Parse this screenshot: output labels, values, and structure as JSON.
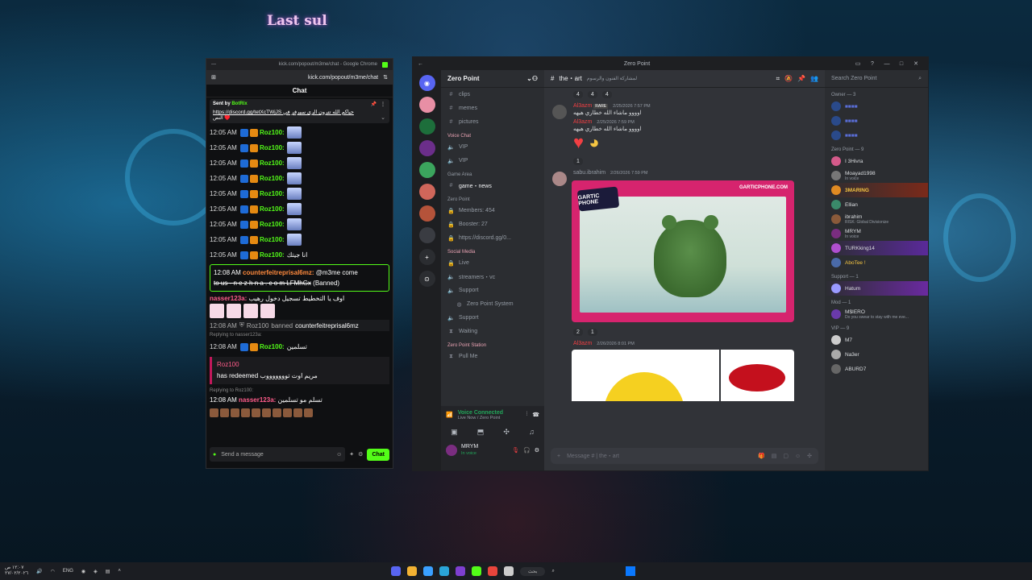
{
  "overlay": {
    "title": "Last sul"
  },
  "chat_window": {
    "chrome_title": "kick.com/popout/m3me/chat - Google Chrome",
    "url": "kick.com/popout/m3me/chat",
    "header": "Chat",
    "pinned": {
      "sent_by_label": "Sent by",
      "sent_by_user": "BotRix",
      "link": "https://discord.gg/tetXcTWjJS حياكم الله تترون الرى سيرفر في",
      "tail": "النص ♥️"
    },
    "rows": [
      {
        "time": "12:05 AM",
        "user": "Roz100:"
      },
      {
        "time": "12:05 AM",
        "user": "Roz100:"
      },
      {
        "time": "12:05 AM",
        "user": "Roz100:"
      },
      {
        "time": "12:05 AM",
        "user": "Roz100:"
      },
      {
        "time": "12:05 AM",
        "user": "Roz100:"
      },
      {
        "time": "12:05 AM",
        "user": "Roz100:"
      },
      {
        "time": "12:05 AM",
        "user": "Roz100:"
      },
      {
        "time": "12:05 AM",
        "user": "Roz100:"
      }
    ],
    "last_roz": {
      "time": "12:05 AM",
      "user": "Roz100:",
      "text": "انا جيتك"
    },
    "highlight": {
      "time": "12:08 AM",
      "user": "counterfeitreprisal6mz:",
      "text": "@m3me come",
      "text2": "to us - n e z h n a . c o m LFMhGx",
      "status": "(Banned)"
    },
    "nasser_msg": {
      "user": "nasser123a:",
      "text": "اوف يا التخطيط تسجيل دخول رهيب"
    },
    "mod_line": {
      "time": "12:08 AM",
      "user": "Roz100",
      "action": "banned",
      "target": "counterfeitreprisal6mz"
    },
    "reply1": "Replying to nasser123a:",
    "reply_row": {
      "time": "12:08 AM",
      "user": "Roz100:",
      "text": "تسلمين"
    },
    "redeem": {
      "user": "Roz100",
      "text": "has redeemed",
      "reward": "مريم اوت توووووووب"
    },
    "reply2": "Replying to Roz100:",
    "reply2_row": {
      "time": "12:08 AM",
      "user": "nasser123a:",
      "text": "تسلم مو تسلمين"
    },
    "input_placeholder": "Send a message",
    "chat_button": "Chat"
  },
  "discord": {
    "window_title": "Zero Point",
    "server_name": "Zero Point",
    "channel_title": "the・art",
    "channel_desc": "لمشاركة الفنون والرسوم",
    "search_placeholder": "Search Zero Point",
    "channels": [
      {
        "label": "clips",
        "icon": "#"
      },
      {
        "label": "memes",
        "icon": "#"
      },
      {
        "label": "pictures",
        "icon": "#"
      }
    ],
    "cat_voice": "Voice Chat",
    "voice": [
      {
        "label": "VIP"
      },
      {
        "label": "VIP"
      }
    ],
    "cat_game": "Game Area",
    "game": [
      {
        "label": "game・news"
      }
    ],
    "cat_zero": "Zero Point",
    "zero": [
      {
        "label": "Members: 454"
      },
      {
        "label": "Booster: 27"
      },
      {
        "label": "https://discord.gg/0..."
      }
    ],
    "cat_social": "Social Media",
    "social": [
      {
        "label": "Live"
      },
      {
        "label": "streamers・vc"
      },
      {
        "label": "Support"
      },
      {
        "label": "Zero Point System"
      },
      {
        "label": "Support"
      },
      {
        "label": "Waiting"
      }
    ],
    "cat_station": "Zero Point Station",
    "station": [
      {
        "label": "Pull Me"
      }
    ],
    "voice_status": "Voice Connected",
    "voice_sub": "Live Now / Zero Point",
    "user_name": "MRYM",
    "user_status": "In voice",
    "messages": [
      {
        "name": "Al3azm",
        "date": "2/25/2026 7:57 PM",
        "body": "اوووو ماشاء الله خطاري هيهه",
        "badge": "RARE"
      },
      {
        "name": "Al3azm",
        "date": "2/25/2026 7:59 PM",
        "body": "اوووو ماشاء الله خطاري هيهه"
      },
      {
        "name": "sabu.ibrahim",
        "date": "2/26/2026 7:59 PM",
        "body": ""
      },
      {
        "name": "Al3azm",
        "date": "2/26/2026 8:01 PM",
        "body": ""
      }
    ],
    "reactions_top": [
      "4",
      "4",
      "4"
    ],
    "reactions_mid": [
      "1"
    ],
    "reactions_gartic": [
      "2",
      "1"
    ],
    "gartic_logo": "GARTIC PHONE",
    "gartic_url": "GARTICPHONE.COM",
    "composer_placeholder": "Message #  | the・art",
    "members": {
      "owner": "Owner — 3",
      "zero": "Zero Point — 9",
      "support": "Support — 1",
      "mod": "Mod — 1",
      "vip": "VIP — 9",
      "list": [
        {
          "name": "I 3Hivra",
          "status": ""
        },
        {
          "name": "Moayad1998",
          "status": "In voice"
        },
        {
          "name": "3MARING",
          "status": ""
        },
        {
          "name": "Ellian",
          "status": ""
        },
        {
          "name": "ibrahim",
          "status": "RISK: Global Divisionize"
        },
        {
          "name": "MRYM",
          "status": "In voice"
        },
        {
          "name": "TURKking14",
          "status": ""
        },
        {
          "name": "AboTee !",
          "status": ""
        },
        {
          "name": "Hatum",
          "status": ""
        },
        {
          "name": "M$IERO",
          "status": "Do you swear to stay with me eve..."
        },
        {
          "name": "M7",
          "status": ""
        },
        {
          "name": "Na3er",
          "status": ""
        },
        {
          "name": "ABURD7",
          "status": ""
        }
      ]
    }
  },
  "taskbar": {
    "time": "١٢:٠٧ ص",
    "date": "٢٧/٠٢/٢٠٢٦",
    "lang": "ENG",
    "search": "بحث"
  },
  "colors": {
    "kick_green": "#53fc18",
    "discord_bg": "#313338",
    "gartic_pink": "#d6246e"
  }
}
